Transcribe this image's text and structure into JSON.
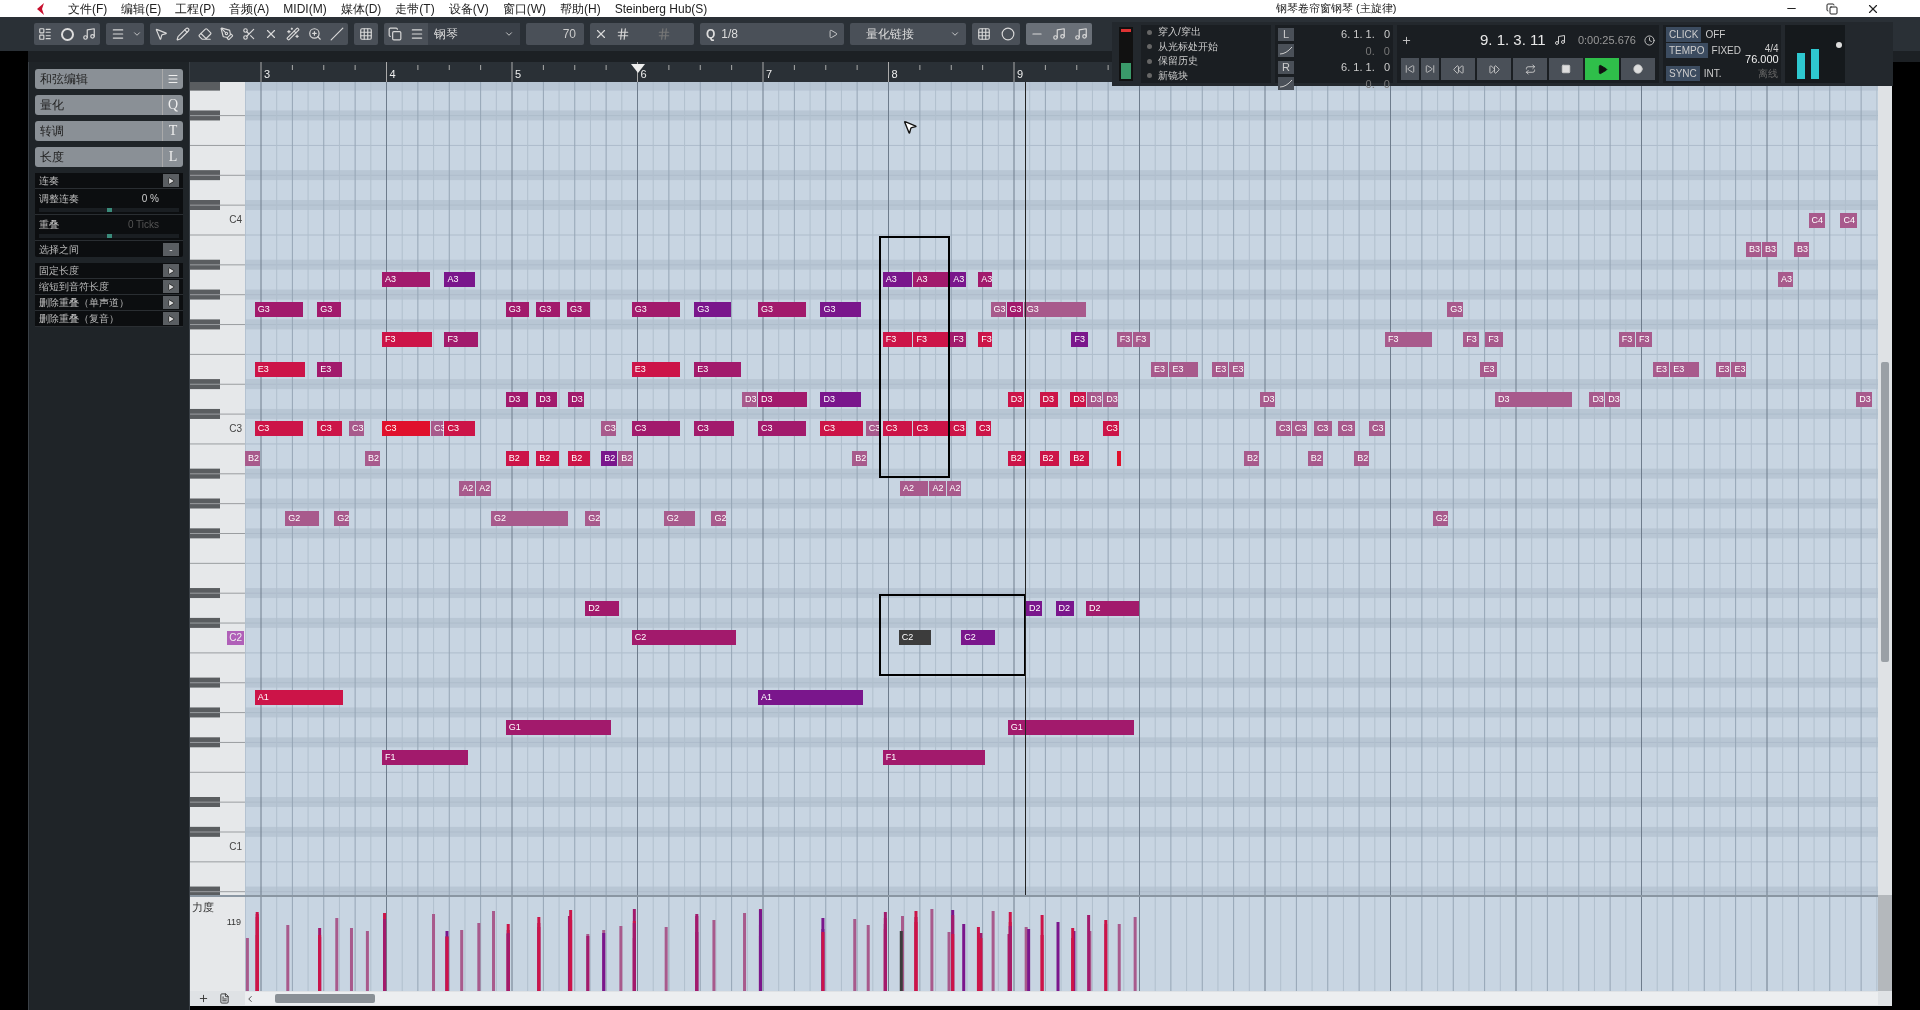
{
  "window": {
    "title": "钢琴卷帘窗钢琴 (主旋律)"
  },
  "menu": [
    "文件(F)",
    "编辑(E)",
    "工程(P)",
    "音频(A)",
    "MIDI(M)",
    "媒体(D)",
    "走带(T)",
    "设备(V)",
    "窗口(W)",
    "帮助(H)",
    "Steinberg Hub(S)"
  ],
  "toolbar": {
    "instrument": "钢琴",
    "velocity": "70",
    "quantize_key": "Q",
    "quantize": "1/8",
    "length": "量化链接"
  },
  "transport": {
    "punch": [
      "穿入/穿出",
      "从光标处开始",
      "保留历史",
      "新镜块"
    ],
    "locators": [
      {
        "label": "L",
        "position": "6. 1. 1.   0",
        "offset": "0.   0"
      },
      {
        "label": "R",
        "position": "6. 1. 1.   0",
        "offset": "0.   0"
      }
    ],
    "position": "9. 1. 3. 11",
    "time": "0:00:25.676",
    "playing": true,
    "click": {
      "label": "CLICK",
      "value": "OFF"
    },
    "tempo": {
      "label": "TEMPO",
      "value": "FIXED",
      "signature": "4/4",
      "bpm": "76.000"
    },
    "sync": {
      "label": "SYNC",
      "value": "INT.",
      "mode": "离线"
    }
  },
  "left_panel": {
    "sections": [
      {
        "label": "和弦编辑"
      },
      {
        "label": "量化",
        "key": "Q"
      },
      {
        "label": "转调",
        "key": "T"
      },
      {
        "label": "长度",
        "key": "L"
      }
    ],
    "legato": [
      {
        "kind": "action",
        "label": "连奏"
      },
      {
        "kind": "value",
        "label": "调整连奏",
        "value": "0 %",
        "level": 0.5,
        "disabled": false
      },
      {
        "kind": "value",
        "label": "重叠",
        "value": "0 Ticks",
        "level": 0.5,
        "disabled": true
      },
      {
        "kind": "select",
        "label": "选择之间",
        "value": "-"
      }
    ],
    "length_actions": [
      "固定长度",
      "缩短到音符长度",
      "删除重叠（单声道）",
      "删除重叠（复音）"
    ]
  },
  "ruler": [
    "3",
    "4",
    "5",
    "6",
    "7",
    "8",
    "9"
  ],
  "keyboard": [
    {
      "label": "C4",
      "selected": false
    },
    {
      "label": "C3",
      "selected": false
    },
    {
      "label": "C2",
      "selected": true
    },
    {
      "label": "C1",
      "selected": false
    }
  ],
  "notes": [
    {
      "label": "A3",
      "color": "#a21a6c"
    },
    {
      "label": "A3",
      "color": "#7a168c"
    },
    {
      "label": "A3",
      "color": "#7a168c"
    },
    {
      "label": "A3",
      "color": "#a21a6c"
    },
    {
      "label": "A3",
      "color": "#7a168c"
    },
    {
      "label": "A3",
      "color": "#a21a6c"
    },
    {
      "label": "A3",
      "color": "#a85a8c"
    },
    {
      "label": "B3",
      "color": "#a85a8c"
    },
    {
      "label": "B3",
      "color": "#a85a8c"
    },
    {
      "label": "B3",
      "color": "#a85a8c"
    },
    {
      "label": "C4",
      "color": "#a85a8c"
    },
    {
      "label": "C4",
      "color": "#a85a8c"
    },
    {
      "label": "G3",
      "color": "#a21a6c"
    },
    {
      "label": "G3",
      "color": "#a21a6c"
    },
    {
      "label": "G3",
      "color": "#a21a6c"
    },
    {
      "label": "G3",
      "color": "#a21a6c"
    },
    {
      "label": "G3",
      "color": "#a21a6c"
    },
    {
      "label": "G3",
      "color": "#a21a6c"
    },
    {
      "label": "G3",
      "color": "#7a168c"
    },
    {
      "label": "G3",
      "color": "#a21a6c"
    },
    {
      "label": "G3",
      "color": "#7a168c"
    },
    {
      "label": "G3",
      "color": "#a85a8c"
    },
    {
      "label": "G3",
      "color": "#a21a6c"
    },
    {
      "label": "G3",
      "color": "#a85a8c"
    },
    {
      "label": "G3",
      "color": "#a85a8c"
    },
    {
      "label": "F3",
      "color": "#cc1448"
    },
    {
      "label": "F3",
      "color": "#a21a6c"
    },
    {
      "label": "F3",
      "color": "#cc1448"
    },
    {
      "label": "F3",
      "color": "#cc1448"
    },
    {
      "label": "F3",
      "color": "#a21a6c"
    },
    {
      "label": "F3",
      "color": "#cc1448"
    },
    {
      "label": "F3",
      "color": "#7a168c"
    },
    {
      "label": "F3",
      "color": "#a85a8c"
    },
    {
      "label": "F3",
      "color": "#a85a8c"
    },
    {
      "label": "F3",
      "color": "#a85a8c"
    },
    {
      "label": "F3",
      "color": "#a85a8c"
    },
    {
      "label": "F3",
      "color": "#a85a8c"
    },
    {
      "label": "F3",
      "color": "#a85a8c"
    },
    {
      "label": "F3",
      "color": "#a85a8c"
    },
    {
      "label": "E3",
      "color": "#cc1448"
    },
    {
      "label": "E3",
      "color": "#a21a6c"
    },
    {
      "label": "E3",
      "color": "#cc1448"
    },
    {
      "label": "E3",
      "color": "#a21a6c"
    },
    {
      "label": "E3",
      "color": "#a85a8c"
    },
    {
      "label": "E3",
      "color": "#a85a8c"
    },
    {
      "label": "E3",
      "color": "#a85a8c"
    },
    {
      "label": "E3",
      "color": "#a85a8c"
    },
    {
      "label": "E3",
      "color": "#a85a8c"
    },
    {
      "label": "E3",
      "color": "#a85a8c"
    },
    {
      "label": "E3",
      "color": "#a85a8c"
    },
    {
      "label": "E3",
      "color": "#a85a8c"
    },
    {
      "label": "E3",
      "color": "#a85a8c"
    },
    {
      "label": "D3",
      "color": "#a21a6c"
    },
    {
      "label": "D3",
      "color": "#a21a6c"
    },
    {
      "label": "D3",
      "color": "#a21a6c"
    },
    {
      "label": "D3",
      "color": "#a85a8c"
    },
    {
      "label": "D3",
      "color": "#a21a6c"
    },
    {
      "label": "D3",
      "color": "#7a168c"
    },
    {
      "label": "D3",
      "color": "#cc1448"
    },
    {
      "label": "D3",
      "color": "#cc1448"
    },
    {
      "label": "D3",
      "color": "#cc1448"
    },
    {
      "label": "D3",
      "color": "#a85a8c"
    },
    {
      "label": "D3",
      "color": "#a85a8c"
    },
    {
      "label": "D3",
      "color": "#a85a8c"
    },
    {
      "label": "D3",
      "color": "#a85a8c"
    },
    {
      "label": "D3",
      "color": "#a85a8c"
    },
    {
      "label": "D3",
      "color": "#a85a8c"
    },
    {
      "label": "D3",
      "color": "#a85a8c"
    },
    {
      "label": "C3",
      "color": "#cc1448"
    },
    {
      "label": "C3",
      "color": "#cc1448"
    },
    {
      "label": "C3",
      "color": "#a85a8c"
    },
    {
      "label": "C3",
      "color": "#e0102c"
    },
    {
      "label": "C3",
      "color": "#a85a8c"
    },
    {
      "label": "C3",
      "color": "#cc1448"
    },
    {
      "label": "C3",
      "color": "#a85a8c"
    },
    {
      "label": "C3",
      "color": "#a21a6c"
    },
    {
      "label": "C3",
      "color": "#a21a6c"
    },
    {
      "label": "C3",
      "color": "#a21a6c"
    },
    {
      "label": "C3",
      "color": "#cc1448"
    },
    {
      "label": "C3",
      "color": "#a85a8c"
    },
    {
      "label": "C3",
      "color": "#cc1448"
    },
    {
      "label": "C3",
      "color": "#cc1448"
    },
    {
      "label": "C3",
      "color": "#cc1448"
    },
    {
      "label": "C3",
      "color": "#cc1448"
    },
    {
      "label": "C3",
      "color": "#cc1448"
    },
    {
      "label": "C3",
      "color": "#a85a8c"
    },
    {
      "label": "C3",
      "color": "#a85a8c"
    },
    {
      "label": "C3",
      "color": "#a85a8c"
    },
    {
      "label": "C3",
      "color": "#a85a8c"
    },
    {
      "label": "C3",
      "color": "#a85a8c"
    },
    {
      "label": "B2",
      "color": "#a85a8c"
    },
    {
      "label": "B2",
      "color": "#a85a8c"
    },
    {
      "label": "B2",
      "color": "#cc1448"
    },
    {
      "label": "B2",
      "color": "#cc1448"
    },
    {
      "label": "B2",
      "color": "#cc1448"
    },
    {
      "label": "B2",
      "color": "#7a168c"
    },
    {
      "label": "B2",
      "color": "#a85a8c"
    },
    {
      "label": "B2",
      "color": "#a85a8c"
    },
    {
      "label": "B2",
      "color": "#cc1448"
    },
    {
      "label": "B2",
      "color": "#cc1448"
    },
    {
      "label": "B2",
      "color": "#cc1448"
    },
    {
      "label": "B2",
      "color": "#a85a8c"
    },
    {
      "label": "B2",
      "color": "#a85a8c"
    },
    {
      "label": "B2",
      "color": "#a85a8c"
    },
    {
      "label": "A2",
      "color": "#a85a8c"
    },
    {
      "label": "A2",
      "color": "#a85a8c"
    },
    {
      "label": "A2",
      "color": "#a85a8c"
    },
    {
      "label": "A2",
      "color": "#a85a8c"
    },
    {
      "label": "A2",
      "color": "#a85a8c"
    },
    {
      "label": "G2",
      "color": "#a85a8c"
    },
    {
      "label": "G2",
      "color": "#a85a8c"
    },
    {
      "label": "G2",
      "color": "#a85a8c"
    },
    {
      "label": "G2",
      "color": "#a85a8c"
    },
    {
      "label": "G2",
      "color": "#a85a8c"
    },
    {
      "label": "G2",
      "color": "#a85a8c"
    },
    {
      "label": "G2",
      "color": "#a85a8c"
    },
    {
      "label": "D2",
      "color": "#a21a6c"
    },
    {
      "label": "D2",
      "color": "#7a168c"
    },
    {
      "label": "D2",
      "color": "#7a168c"
    },
    {
      "label": "D2",
      "color": "#a21a6c"
    },
    {
      "label": "C2",
      "color": "#a21a6c"
    },
    {
      "label": "C2",
      "color": "#3c3c3c"
    },
    {
      "label": "C2",
      "color": "#7a168c"
    },
    {
      "label": "A1",
      "color": "#cc1448"
    },
    {
      "label": "A1",
      "color": "#7a168c"
    },
    {
      "label": "G1",
      "color": "#a21a6c"
    },
    {
      "label": "G1",
      "color": "#a21a6c"
    },
    {
      "label": "F1",
      "color": "#a21a6c"
    },
    {
      "label": "F1",
      "color": "#a21a6c"
    }
  ],
  "velocity_lane": {
    "label": "力度",
    "max": "119"
  }
}
